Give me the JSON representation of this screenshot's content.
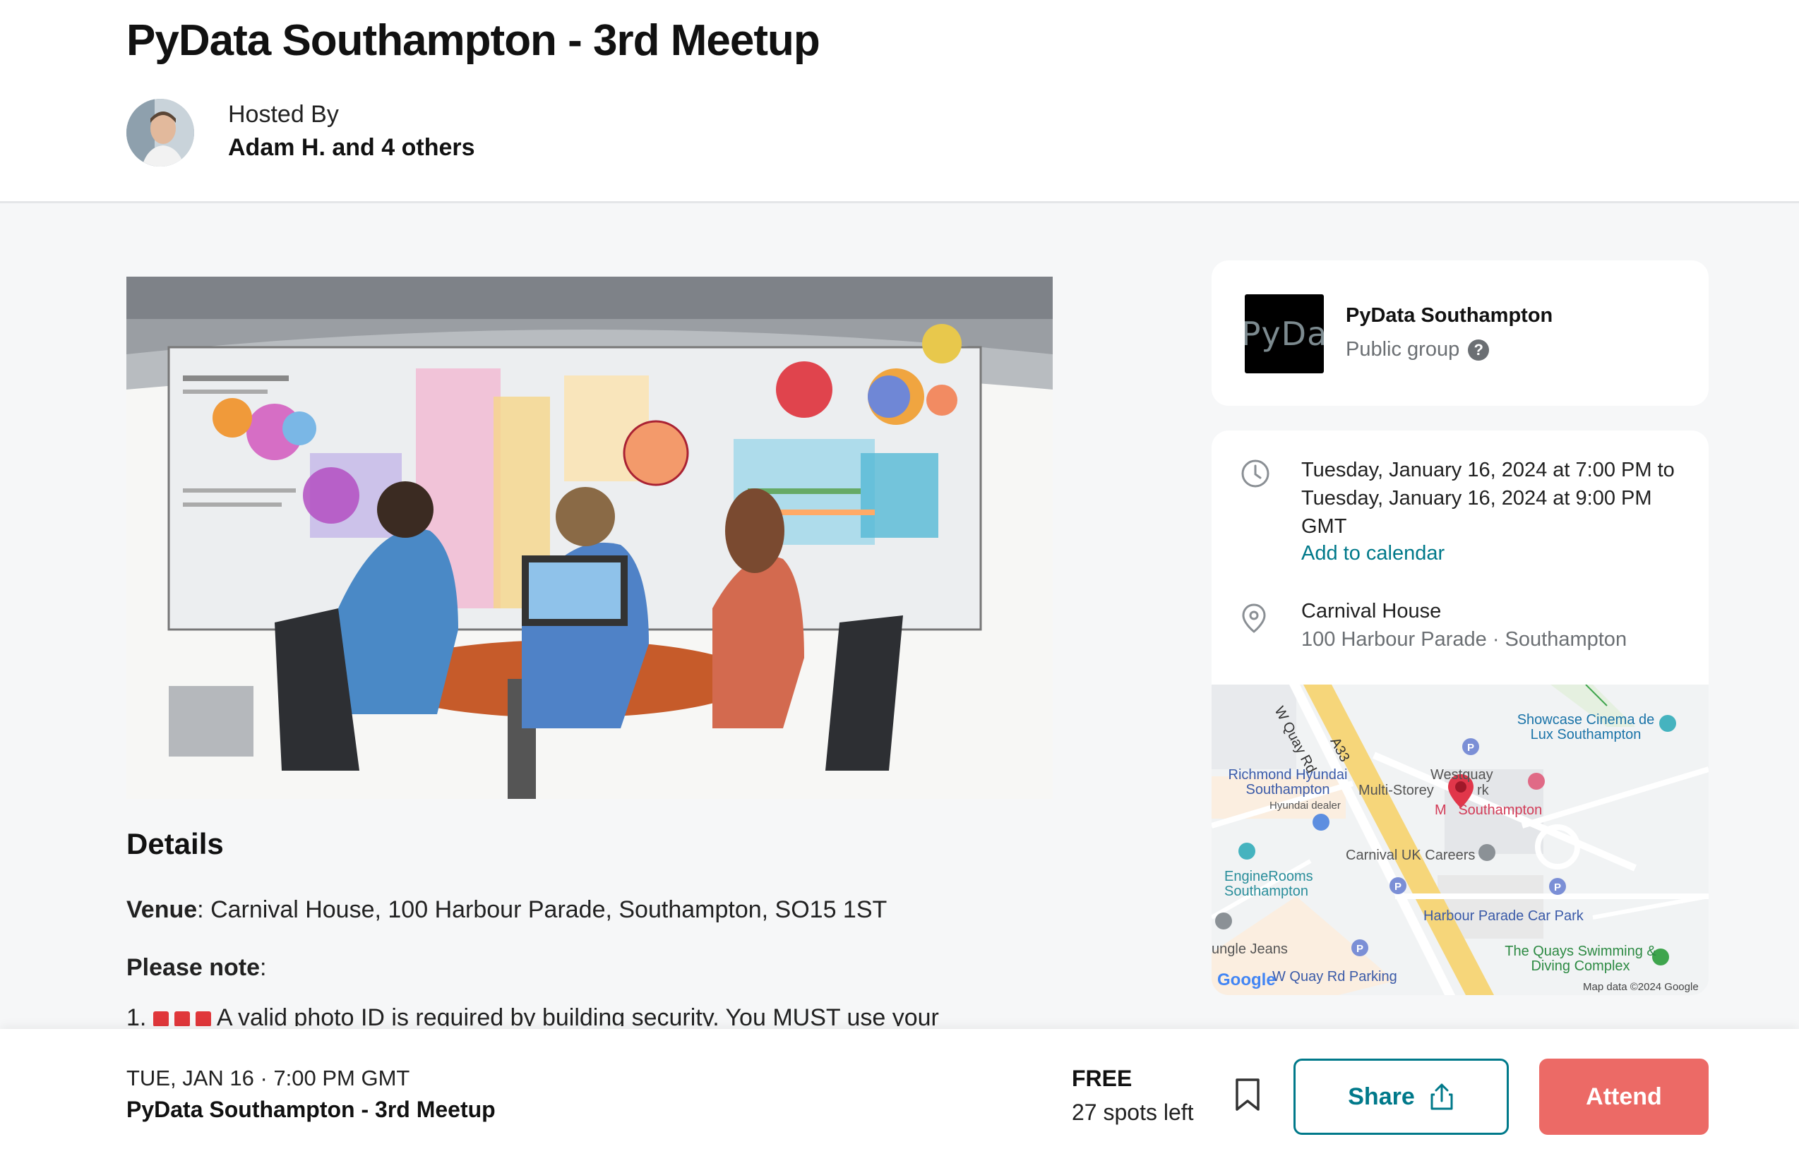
{
  "header": {
    "title": "PyData Southampton - 3rd Meetup",
    "hosted_by_label": "Hosted By",
    "host_names": "Adam H. and 4 others"
  },
  "details": {
    "heading": "Details",
    "venue_label": "Venue",
    "venue_value": ": Carnival House, 100 Harbour Parade, Southampton, SO15 1ST",
    "note_label": "Please note",
    "note_suffix": ":",
    "list_number": "1.",
    "list_text": "A valid photo ID is required by building security. You MUST use your"
  },
  "group": {
    "logo_text": "PyDa",
    "name": "PyData Southampton",
    "type": "Public group"
  },
  "event_info": {
    "datetime": "Tuesday, January 16, 2024 at 7:00 PM to Tuesday, January 16, 2024 at 9:00 PM GMT",
    "add_to_calendar": "Add to calendar",
    "venue_name": "Carnival House",
    "venue_address": "100 Harbour Parade · Southampton"
  },
  "map": {
    "labels": {
      "road_w_quay": "W Quay Rd",
      "road_a33": "A33",
      "showcase": "Showcase Cinema de Lux Southampton",
      "richmond": "Richmond Hyundai Southampton",
      "hyundai_dealer": "Hyundai dealer",
      "multi_storey": "Multi-Storey",
      "westquay": "Westquay",
      "park": "rk",
      "southampton": "M   Southampton",
      "carnival_careers": "Carnival UK Careers",
      "enginerooms": "EngineRooms Southampton",
      "harbour_parking": "Harbour Parade Car Park",
      "jungle": "ungle Jeans",
      "quays": "The Quays Swimming & Diving Complex",
      "quay_parking": "W Quay Rd Parking",
      "google": "Google",
      "map_data": "Map data ©2024 Google"
    }
  },
  "footer": {
    "date": "TUE, JAN 16 · 7:00 PM GMT",
    "title": "PyData Southampton - 3rd Meetup",
    "price": "FREE",
    "spots": "27 spots left",
    "share_label": "Share",
    "attend_label": "Attend"
  },
  "colors": {
    "accent_teal": "#00798a",
    "attend_red": "#ec6a66",
    "page_bg": "#f6f7f8"
  },
  "icons": [
    "clock-icon",
    "location-pin-icon",
    "help-icon",
    "bookmark-icon",
    "share-icon"
  ]
}
